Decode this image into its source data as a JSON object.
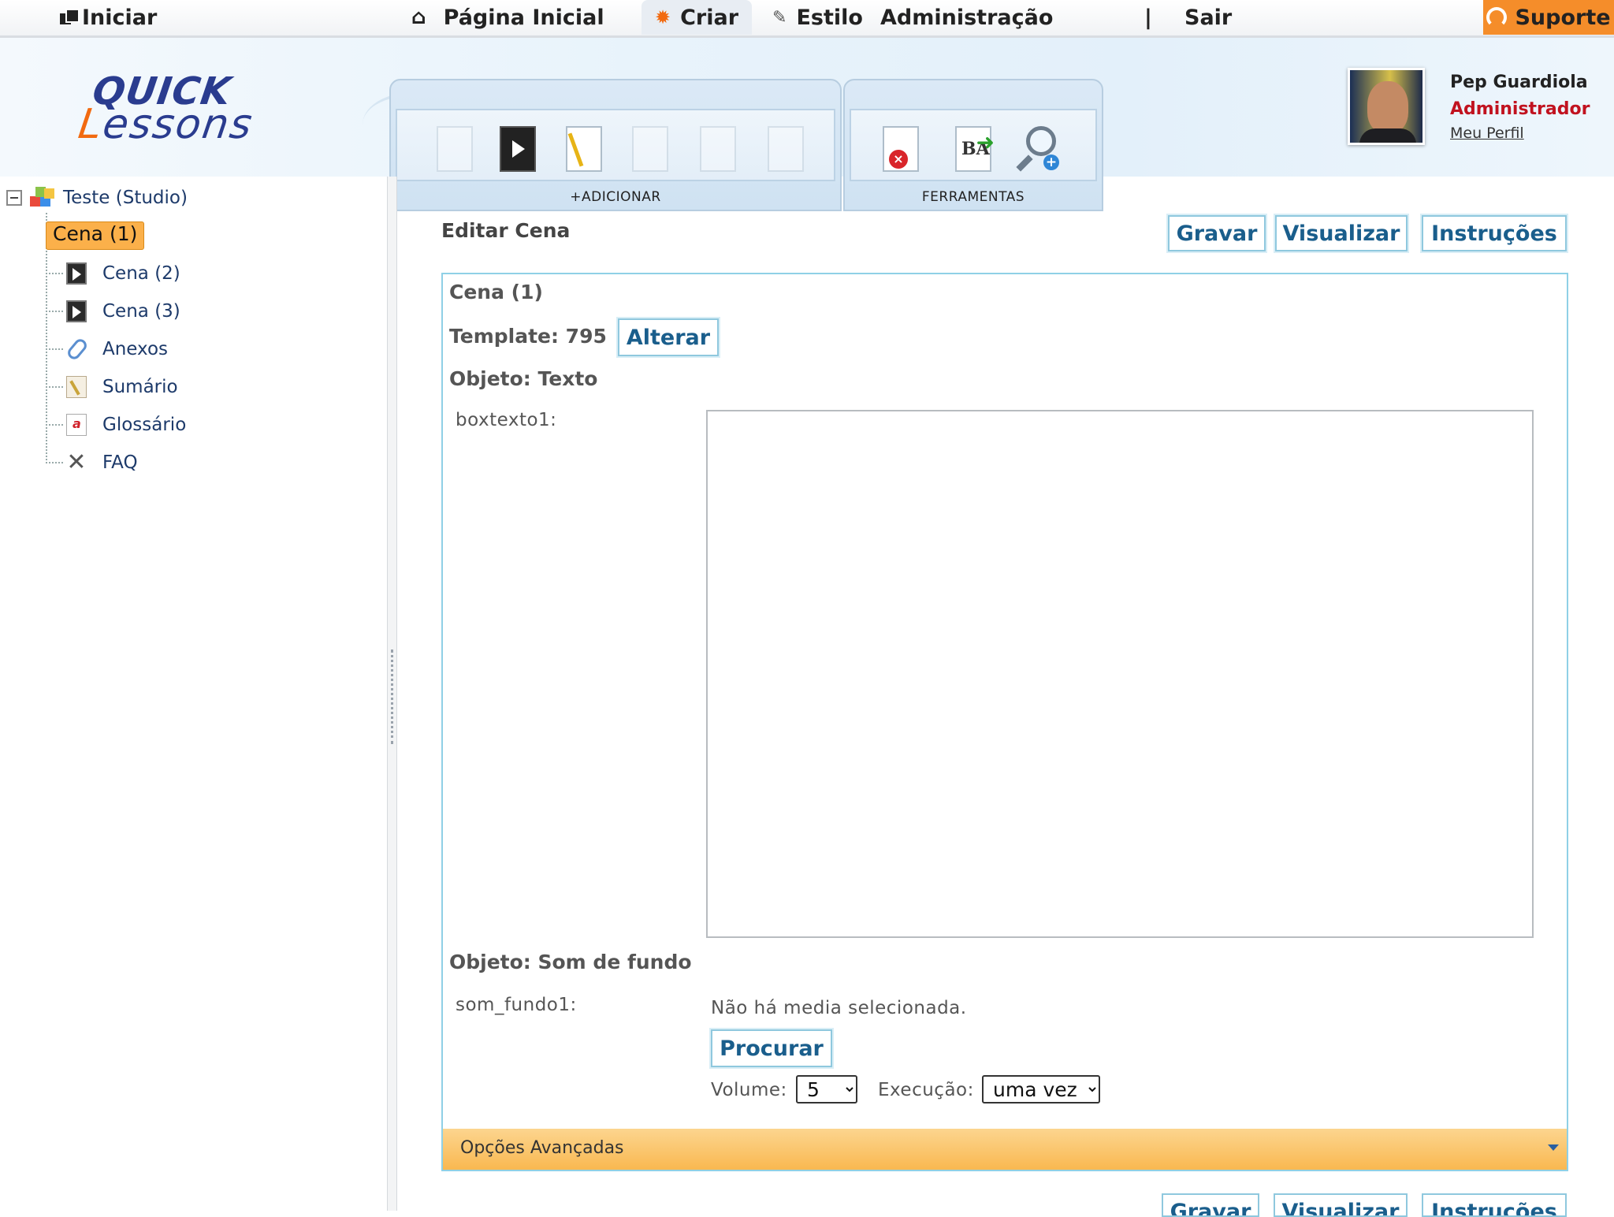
{
  "topbar": {
    "iniciar": "Iniciar",
    "pagina_inicial": "Página Inicial",
    "criar": "Criar",
    "estilo": "Estilo",
    "administracao": "Administração",
    "separator": "|",
    "sair": "Sair",
    "suporte": "Suporte"
  },
  "logo": {
    "line1": "QUICK",
    "line2": "Lessons"
  },
  "toolbar": {
    "add_caption": "+ADICIONAR",
    "tools_caption": "FERRAMENTAS"
  },
  "user": {
    "name": "Pep Guardiola",
    "role": "Administrador",
    "profile_link": "Meu Perfil"
  },
  "tree": {
    "root": "Teste (Studio)",
    "items": [
      {
        "label": "Cena (1)",
        "icon": "scene-film-icon",
        "selected": true
      },
      {
        "label": "Cena (2)",
        "icon": "scene-film-icon",
        "selected": false
      },
      {
        "label": "Cena (3)",
        "icon": "scene-film-icon",
        "selected": false
      },
      {
        "label": "Anexos",
        "icon": "paperclip-icon",
        "selected": false
      },
      {
        "label": "Sumário",
        "icon": "summary-icon",
        "selected": false
      },
      {
        "label": "Glossário",
        "icon": "glossary-icon",
        "selected": false
      },
      {
        "label": "FAQ",
        "icon": "tools-icon",
        "selected": false
      }
    ]
  },
  "main": {
    "title": "Editar Cena",
    "buttons": {
      "save": "Gravar",
      "preview": "Visualizar",
      "instructions": "Instruções"
    }
  },
  "editor": {
    "scene": "Cena (1)",
    "template_label": "Template: 795",
    "alterar": "Alterar",
    "obj_text_label": "Objeto: Texto",
    "boxtexto_label": "boxtexto1:",
    "boxtexto_value": "",
    "obj_sound_label": "Objeto: Som de fundo",
    "som_label": "som_fundo1:",
    "no_media": "Não há media selecionada.",
    "procurar": "Procurar",
    "volume_label": "Volume:",
    "volume_value": "5",
    "execucao_label": "Execução:",
    "execucao_value": "uma vez"
  },
  "advanced": {
    "label": "Opções Avançadas"
  },
  "colors": {
    "accent": "#f26a10",
    "link": "#1a5e8c",
    "selected": "#fbb04a",
    "role": "#c1121f"
  }
}
